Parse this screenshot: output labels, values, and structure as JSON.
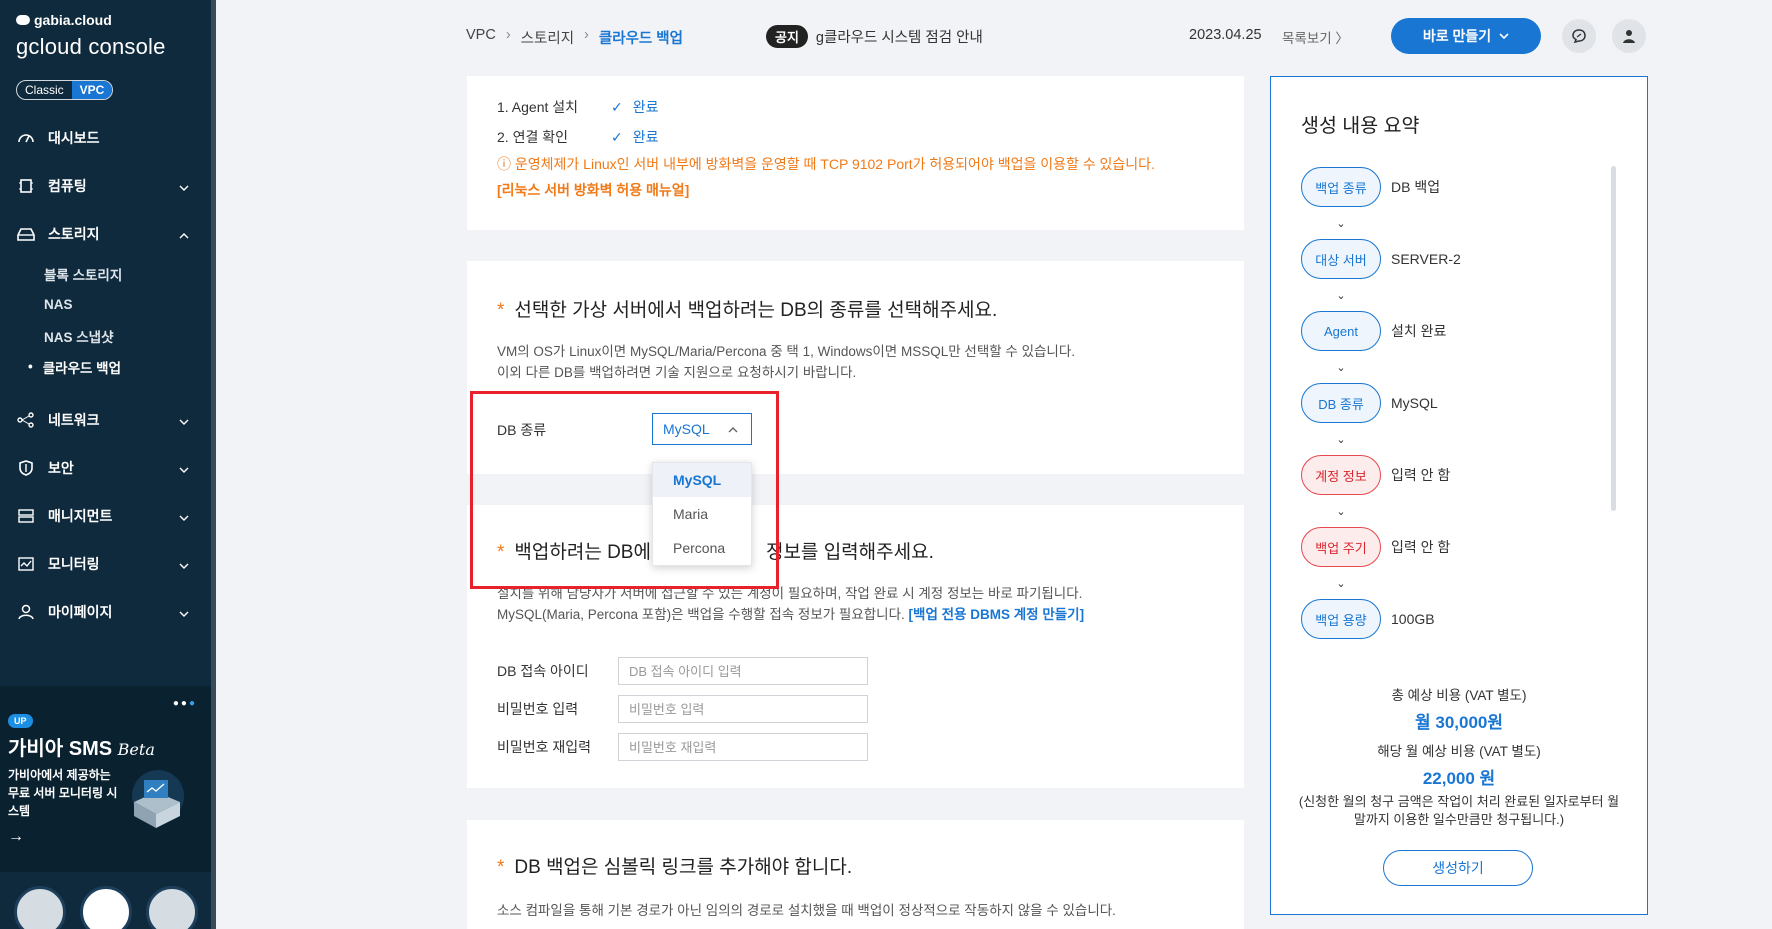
{
  "brand": {
    "top": "gabia.cloud",
    "console": "gcloud console",
    "mode_classic": "Classic",
    "mode_vpc": "VPC"
  },
  "nav": {
    "dashboard": "대시보드",
    "compute": "컴퓨팅",
    "storage": "스토리지",
    "storage_sub": [
      "블록 스토리지",
      "NAS",
      "NAS 스냅샷",
      "클라우드 백업"
    ],
    "network": "네트워크",
    "security": "보안",
    "management": "매니지먼트",
    "monitoring": "모니터링",
    "mypage": "마이페이지"
  },
  "promo": {
    "badge": "UP",
    "title": "가비아 SMS",
    "beta": "Beta",
    "desc": "가비아에서 제공하는 무료 서버 모니터링 시스템",
    "arrow": "→"
  },
  "breadcrumb": {
    "a": "VPC",
    "b": "스토리지",
    "c": "클라우드 백업",
    "sep": "›"
  },
  "notice": {
    "tag": "공지",
    "text": "g클라우드 시스템 점검 안내",
    "date": "2023.04.25",
    "more": "목록보기 〉"
  },
  "header": {
    "create_label": "바로 만들기"
  },
  "steps": {
    "s1": "1. Agent 설치",
    "s2": "2. 연결 확인",
    "status": "완료",
    "check": "✓",
    "warning": "ⓘ 운영체제가 Linux인 서버 내부에 방화벽을 운영할 때 TCP 9102 Port가 허용되어야 백업을 이용할 수 있습니다.",
    "warning_link": "[리눅스 서버 방화벽 허용 매뉴얼]"
  },
  "db_type": {
    "question": "선택한 가상 서버에서 백업하려는 DB의 종류를 선택해주세요.",
    "desc1": "VM의 OS가 Linux이면 MySQL/Maria/Percona 중 택 1, Windows이면 MSSQL만 선택할 수 있습니다.",
    "desc2": "이외 다른 DB를 백업하려면 기술 지원으로 요청하시기 바랍니다.",
    "label": "DB 종류",
    "selected": "MySQL",
    "options": [
      "MySQL",
      "Maria",
      "Percona"
    ]
  },
  "account": {
    "question_pre": "백업하려는 DB에",
    "question_post": "정보를 입력해주세요.",
    "desc1": "설치를 위해 담당자가 서버에 접근할 수 있는 계정이 필요하며, 작업 완료 시 계정 정보는 바로 파기됩니다.",
    "desc2": "MySQL(Maria, Percona 포함)은 백업을 수행할 접속 정보가 필요합니다.",
    "desc2_link": "[백업 전용 DBMS 계정 만들기]",
    "id_label": "DB 접속 아이디",
    "id_placeholder": "DB 접속 아이디 입력",
    "pw_label": "비밀번호 입력",
    "pw_placeholder": "비밀번호 입력",
    "pw2_label": "비밀번호 재입력",
    "pw2_placeholder": "비밀번호 재입력"
  },
  "symlink": {
    "question": "DB 백업은 심볼릭 링크를 추가해야 합니다.",
    "desc": "소스 컴파일을 통해 기본 경로가 아닌 임의의 경로로 설치했을 때 백업이 정상적으로 작동하지 않을 수 있습니다."
  },
  "summary": {
    "title": "생성 내용 요약",
    "rows": [
      {
        "key": "백업 종류",
        "value": "DB 백업",
        "state": "ok"
      },
      {
        "key": "대상 서버",
        "value": "SERVER-2",
        "state": "ok"
      },
      {
        "key": "Agent",
        "value": "설치 완료",
        "state": "ok"
      },
      {
        "key": "DB 종류",
        "value": "MySQL",
        "state": "ok"
      },
      {
        "key": "계정 정보",
        "value": "입력 안 함",
        "state": "warn"
      },
      {
        "key": "백업 주기",
        "value": "입력 안 함",
        "state": "warn"
      },
      {
        "key": "백업 용량",
        "value": "100GB",
        "state": "ok"
      }
    ],
    "total_label": "총 예상 비용 (VAT 별도)",
    "total_value": "월 30,000원",
    "month_label": "해당 월 예상 비용 (VAT 별도)",
    "month_value": "22,000 원",
    "note": "(신청한 월의 청구 금액은 작업이 처리 완료된 일자로부터 월말까지 이용한 일수만큼만 청구됩니다.)",
    "submit": "생성하기"
  },
  "colors": {
    "accent": "#1976d2",
    "sidebar": "#0f2a3d",
    "warning": "#f07a18",
    "highlight": "#e8212b"
  }
}
